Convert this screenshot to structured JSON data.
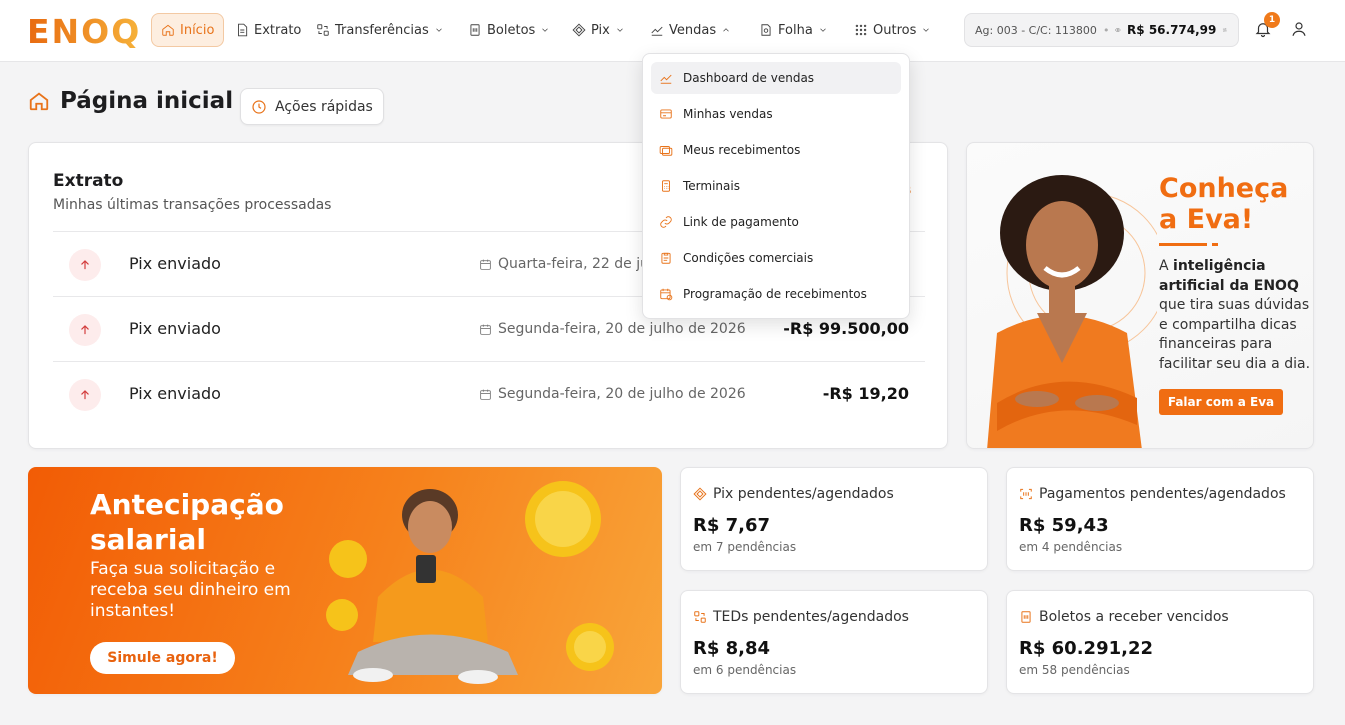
{
  "brand": {
    "logo": "ENOQ"
  },
  "nav": {
    "items": [
      {
        "label": "Início"
      },
      {
        "label": "Extrato"
      },
      {
        "label": "Transferências"
      },
      {
        "label": "Boletos"
      },
      {
        "label": "Pix"
      },
      {
        "label": "Vendas"
      },
      {
        "label": "Folha"
      },
      {
        "label": "Outros"
      }
    ]
  },
  "account": {
    "info": "Ag: 003 - C/C: 113800",
    "separator": "•",
    "balance": "R$ 56.774,99"
  },
  "notifications": {
    "count": "1"
  },
  "page": {
    "title": "Página inicial",
    "quick_actions": "Ações rápidas"
  },
  "extrato": {
    "title": "Extrato",
    "subtitle": "Minhas últimas transações processadas",
    "more_link_partial": "is",
    "transactions": [
      {
        "name": "Pix enviado",
        "date": "Quarta-feira, 22 de ju",
        "amount": ""
      },
      {
        "name": "Pix enviado",
        "date": "Segunda-feira, 20 de julho de 2026",
        "amount": "-R$ 99.500,00"
      },
      {
        "name": "Pix enviado",
        "date": "Segunda-feira, 20 de julho de 2026",
        "amount": "-R$ 19,20"
      }
    ]
  },
  "vendas_menu": {
    "items": [
      {
        "label": "Dashboard de vendas",
        "icon": "chart-line-icon"
      },
      {
        "label": "Minhas vendas",
        "icon": "sales-list-icon"
      },
      {
        "label": "Meus recebimentos",
        "icon": "receivables-icon"
      },
      {
        "label": "Terminais",
        "icon": "terminal-icon"
      },
      {
        "label": "Link de pagamento",
        "icon": "link-icon"
      },
      {
        "label": "Condições comerciais",
        "icon": "clipboard-icon"
      },
      {
        "label": "Programação de recebimentos",
        "icon": "calendar-schedule-icon"
      }
    ]
  },
  "eva": {
    "title_line1": "Conheça",
    "title_line2": "a Eva!",
    "text_prefix": "A ",
    "text_bold": "inteligência artificial da ENOQ",
    "text_rest": " que tira suas dúvidas e compartilha dicas financeiras para facilitar seu dia a dia.",
    "button": "Falar com a Eva"
  },
  "antecipacao": {
    "title_line1": "Antecipação",
    "title_line2": "salarial",
    "text": "Faça sua solicitação e receba seu dinheiro em instantes!",
    "button": "Simule agora!"
  },
  "stats": [
    {
      "title": "Pix pendentes/agendados",
      "value": "R$ 7,67",
      "sub": "em 7 pendências"
    },
    {
      "title": "Pagamentos pendentes/agendados",
      "value": "R$ 59,43",
      "sub": "em 4 pendências"
    },
    {
      "title": "TEDs pendentes/agendados",
      "value": "R$ 8,84",
      "sub": "em 6 pendências"
    },
    {
      "title": "Boletos a receber vencidos",
      "value": "R$ 60.291,22",
      "sub": "em 58 pendências"
    }
  ],
  "colors": {
    "accent": "#e8731a",
    "brand_orange": "#f06d12",
    "negative_icon": "#d23b3b"
  }
}
